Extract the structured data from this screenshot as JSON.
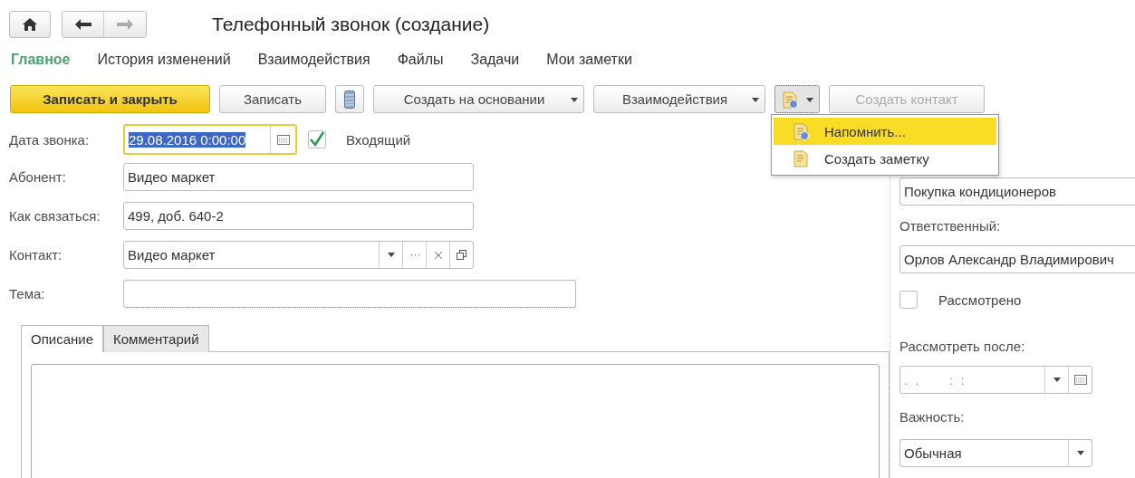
{
  "header": {
    "title": "Телефонный звонок (создание)"
  },
  "nav": [
    {
      "label": "Главное",
      "selected": true
    },
    {
      "label": "История изменений",
      "selected": false
    },
    {
      "label": "Взаимодействия",
      "selected": false
    },
    {
      "label": "Файлы",
      "selected": false
    },
    {
      "label": "Задачи",
      "selected": false
    },
    {
      "label": "Мои заметки",
      "selected": false
    }
  ],
  "toolbar": [
    {
      "kind": "primary",
      "label": "Записать и закрыть",
      "disabled": false
    },
    {
      "kind": "button",
      "label": "Записать",
      "disabled": false
    },
    {
      "kind": "icon",
      "disabled": false
    },
    {
      "kind": "dropdown",
      "label": "Создать на основании",
      "disabled": false
    },
    {
      "kind": "dropdown",
      "label": "Взаимодействия",
      "disabled": false
    },
    {
      "kind": "icon-dropdown",
      "disabled": false,
      "expanded": true
    },
    {
      "kind": "button",
      "label": "Создать контакт",
      "disabled": true
    }
  ],
  "menu": [
    {
      "label": "Напомнить...",
      "selected": true,
      "kind": "remind"
    },
    {
      "label": "Создать заметку",
      "selected": false,
      "kind": "note"
    }
  ],
  "form": {
    "call_date": {
      "label": "Дата звонка:",
      "value": "29.08.2016  0:00:00",
      "focused": true
    },
    "incoming": {
      "label": "Входящий",
      "checked": true
    },
    "fields": [
      {
        "label": "Абонент:",
        "value": "Видео маркет",
        "kind": "text"
      },
      {
        "label": "Как связаться:",
        "value": "499, доб. 640-2",
        "kind": "text"
      },
      {
        "label": "Контакт:",
        "value": "Видео маркет",
        "kind": "reference"
      },
      {
        "label": "Тема:",
        "kind": "wide",
        "required": true
      }
    ],
    "tabs": [
      {
        "label": "Описание",
        "selected": true
      },
      {
        "label": "Комментарий",
        "selected": false
      }
    ]
  },
  "side": {
    "subject": {
      "value": "Покупка кондиционеров"
    },
    "responsible": {
      "label": "Ответственный:",
      "value": "Орлов Александр Владимирович"
    },
    "reviewed": {
      "label": "Рассмотрено",
      "checked": false
    },
    "review_after": {
      "label": "Рассмотреть после:",
      "placeholder": ".  .        :  :"
    },
    "importance": {
      "label": "Важность:",
      "value": "Обычная"
    }
  }
}
